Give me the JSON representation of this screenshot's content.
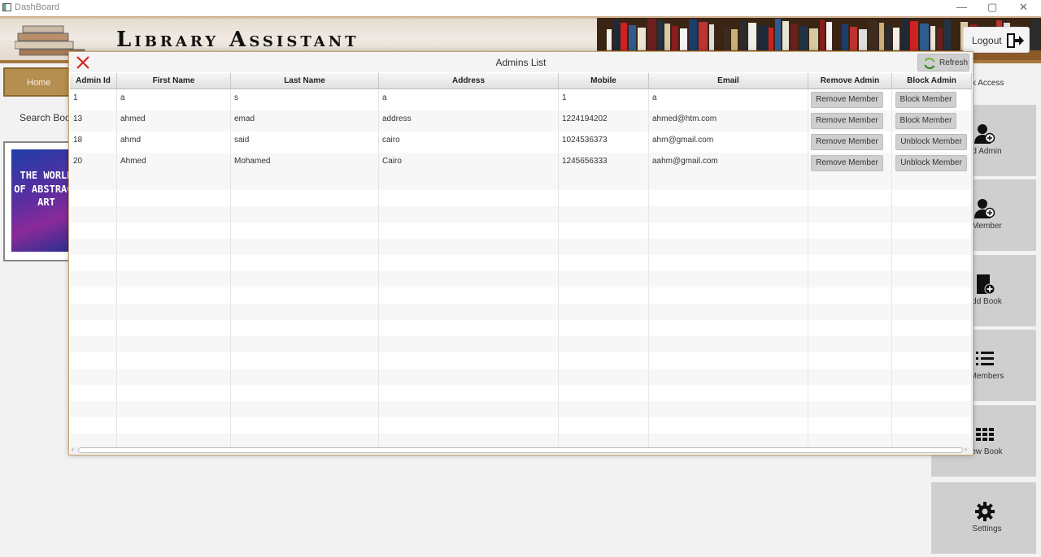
{
  "window": {
    "title": "DashBoard",
    "minimize": "—",
    "maximize": "▢",
    "close": "✕"
  },
  "banner": {
    "brand": "Library Assistant",
    "logout_label": "Logout"
  },
  "left": {
    "home_label": "Home",
    "search_label": "Search Book",
    "book_cover_text": "THE WORLD OF ABSTRACT ART"
  },
  "quick_access": {
    "label": "ck Access",
    "tiles": [
      {
        "label": "d Admin",
        "icon": "add-user-icon"
      },
      {
        "label": " Member",
        "icon": "add-member-icon"
      },
      {
        "label": "dd Book",
        "icon": "add-book-icon"
      },
      {
        "label": " Members",
        "icon": "list-icon"
      },
      {
        "label": "ew Book",
        "icon": "grid-icon"
      },
      {
        "label": "Settings",
        "icon": "gear-icon"
      }
    ]
  },
  "dialog": {
    "title": "Admins List",
    "refresh_label": "Refresh",
    "columns": [
      "Admin Id",
      "First Name",
      "Last Name",
      "Address",
      "Mobile",
      "Email",
      "Remove Admin",
      "Block Admin"
    ],
    "rows": [
      {
        "id": "1",
        "first": "a",
        "last": "s",
        "address": "a",
        "mobile": "1",
        "email": "a",
        "remove": "Remove Member",
        "block": "Block Member"
      },
      {
        "id": "13",
        "first": "ahmed",
        "last": "emad",
        "address": "address",
        "mobile": "1224194202",
        "email": "ahmed@htm.com",
        "remove": "Remove Member",
        "block": "Block Member"
      },
      {
        "id": "18",
        "first": "ahmd",
        "last": "said",
        "address": "cairo",
        "mobile": "1024536373",
        "email": "ahm@gmail.com",
        "remove": "Remove Member",
        "block": "Unblock Member"
      },
      {
        "id": "20",
        "first": "Ahmed",
        "last": "Mohamed",
        "address": "Cairo",
        "mobile": "1245656333",
        "email": "aahm@gmail.com",
        "remove": "Remove Member",
        "block": "Unblock Member"
      }
    ]
  }
}
